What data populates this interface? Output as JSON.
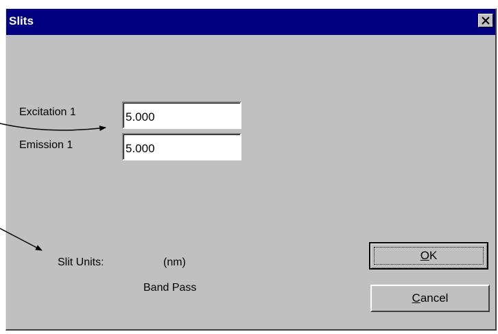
{
  "window": {
    "title": "Slits",
    "close_icon": "close-x-icon"
  },
  "fields": {
    "excitation": {
      "label": "Excitation 1",
      "value": "5.000"
    },
    "emission": {
      "label": "Emission 1",
      "value": "5.000"
    }
  },
  "units": {
    "label": "Slit Units:",
    "unit": "(nm)",
    "mode": "Band Pass"
  },
  "buttons": {
    "ok": {
      "mnemonic": "O",
      "rest": "K"
    },
    "cancel": {
      "mnemonic": "C",
      "rest": "ancel"
    }
  },
  "colors": {
    "titlebar": "#000080",
    "face": "#c0c0c0"
  },
  "annotations": {
    "arrow_icon_1": "arrow-icon",
    "arrow_icon_2": "arrow-icon"
  }
}
